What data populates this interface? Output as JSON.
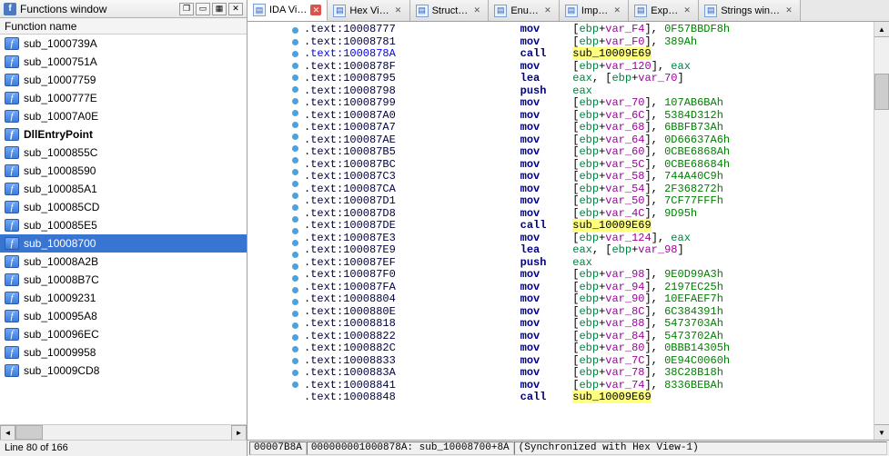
{
  "left": {
    "title": "Functions window",
    "col_header": "Function name",
    "status": "Line 80 of 166",
    "functions": [
      {
        "label": "sub_1000739A"
      },
      {
        "label": "sub_1000751A"
      },
      {
        "label": "sub_10007759"
      },
      {
        "label": "sub_1000777E"
      },
      {
        "label": "sub_10007A0E"
      },
      {
        "label": "DllEntryPoint",
        "bold": true
      },
      {
        "label": "sub_1000855C"
      },
      {
        "label": "sub_10008590"
      },
      {
        "label": "sub_100085A1"
      },
      {
        "label": "sub_100085CD"
      },
      {
        "label": "sub_100085E5"
      },
      {
        "label": "sub_10008700",
        "selected": true
      },
      {
        "label": "sub_10008A2B"
      },
      {
        "label": "sub_10008B7C"
      },
      {
        "label": "sub_10009231"
      },
      {
        "label": "sub_100095A8"
      },
      {
        "label": "sub_100096EC"
      },
      {
        "label": "sub_10009958"
      },
      {
        "label": "sub_10009CD8"
      }
    ]
  },
  "tabs": {
    "items": [
      {
        "label": "IDA Vi…",
        "active": true
      },
      {
        "label": "Hex Vi…"
      },
      {
        "label": "Struct…"
      },
      {
        "label": "Enu…"
      },
      {
        "label": "Imp…"
      },
      {
        "label": "Exp…"
      },
      {
        "label": "Strings win…"
      }
    ]
  },
  "disasm": {
    "lines": [
      {
        "addr": ".text:10008777",
        "mnem": "mov",
        "op": "[ebp+var_F4], 0F57BBDF8h",
        "ops": [
          {
            "t": "[",
            "c": ""
          },
          {
            "t": "ebp",
            "c": "regop"
          },
          {
            "t": "+",
            "c": ""
          },
          {
            "t": "var_F4",
            "c": "varop"
          },
          {
            "t": "], ",
            "c": ""
          },
          {
            "t": "0F57BBDF8h",
            "c": "imm"
          }
        ]
      },
      {
        "addr": ".text:10008781",
        "mnem": "mov",
        "ops": [
          {
            "t": "[",
            "c": ""
          },
          {
            "t": "ebp",
            "c": "regop"
          },
          {
            "t": "+",
            "c": ""
          },
          {
            "t": "var_F0",
            "c": "varop"
          },
          {
            "t": "], ",
            "c": ""
          },
          {
            "t": "389Ah",
            "c": "imm"
          }
        ]
      },
      {
        "addr": ".text:1000878A",
        "addr_blue": true,
        "mnem": "call",
        "ops": [
          {
            "t": "sub_10009E69",
            "c": "callhl"
          }
        ]
      },
      {
        "addr": ".text:1000878F",
        "mnem": "mov",
        "ops": [
          {
            "t": "[",
            "c": ""
          },
          {
            "t": "ebp",
            "c": "regop"
          },
          {
            "t": "+",
            "c": ""
          },
          {
            "t": "var_120",
            "c": "varop"
          },
          {
            "t": "], ",
            "c": ""
          },
          {
            "t": "eax",
            "c": "regop"
          }
        ]
      },
      {
        "addr": ".text:10008795",
        "mnem": "lea",
        "ops": [
          {
            "t": "eax",
            "c": "regop"
          },
          {
            "t": ", [",
            "c": ""
          },
          {
            "t": "ebp",
            "c": "regop"
          },
          {
            "t": "+",
            "c": ""
          },
          {
            "t": "var_70",
            "c": "varop"
          },
          {
            "t": "]",
            "c": ""
          }
        ]
      },
      {
        "addr": ".text:10008798",
        "mnem": "push",
        "ops": [
          {
            "t": "eax",
            "c": "regop"
          }
        ]
      },
      {
        "addr": ".text:10008799",
        "mnem": "mov",
        "ops": [
          {
            "t": "[",
            "c": ""
          },
          {
            "t": "ebp",
            "c": "regop"
          },
          {
            "t": "+",
            "c": ""
          },
          {
            "t": "var_70",
            "c": "varop"
          },
          {
            "t": "], ",
            "c": ""
          },
          {
            "t": "107AB6BAh",
            "c": "imm"
          }
        ]
      },
      {
        "addr": ".text:100087A0",
        "mnem": "mov",
        "ops": [
          {
            "t": "[",
            "c": ""
          },
          {
            "t": "ebp",
            "c": "regop"
          },
          {
            "t": "+",
            "c": ""
          },
          {
            "t": "var_6C",
            "c": "varop"
          },
          {
            "t": "], ",
            "c": ""
          },
          {
            "t": "5384D312h",
            "c": "imm"
          }
        ]
      },
      {
        "addr": ".text:100087A7",
        "mnem": "mov",
        "ops": [
          {
            "t": "[",
            "c": ""
          },
          {
            "t": "ebp",
            "c": "regop"
          },
          {
            "t": "+",
            "c": ""
          },
          {
            "t": "var_68",
            "c": "varop"
          },
          {
            "t": "], ",
            "c": ""
          },
          {
            "t": "6BBFB73Ah",
            "c": "imm"
          }
        ]
      },
      {
        "addr": ".text:100087AE",
        "mnem": "mov",
        "ops": [
          {
            "t": "[",
            "c": ""
          },
          {
            "t": "ebp",
            "c": "regop"
          },
          {
            "t": "+",
            "c": ""
          },
          {
            "t": "var_64",
            "c": "varop"
          },
          {
            "t": "], ",
            "c": ""
          },
          {
            "t": "0D66637A6h",
            "c": "imm"
          }
        ]
      },
      {
        "addr": ".text:100087B5",
        "mnem": "mov",
        "ops": [
          {
            "t": "[",
            "c": ""
          },
          {
            "t": "ebp",
            "c": "regop"
          },
          {
            "t": "+",
            "c": ""
          },
          {
            "t": "var_60",
            "c": "varop"
          },
          {
            "t": "], ",
            "c": ""
          },
          {
            "t": "0CBE6868Ah",
            "c": "imm"
          }
        ]
      },
      {
        "addr": ".text:100087BC",
        "mnem": "mov",
        "ops": [
          {
            "t": "[",
            "c": ""
          },
          {
            "t": "ebp",
            "c": "regop"
          },
          {
            "t": "+",
            "c": ""
          },
          {
            "t": "var_5C",
            "c": "varop"
          },
          {
            "t": "], ",
            "c": ""
          },
          {
            "t": "0CBE68684h",
            "c": "imm"
          }
        ]
      },
      {
        "addr": ".text:100087C3",
        "mnem": "mov",
        "ops": [
          {
            "t": "[",
            "c": ""
          },
          {
            "t": "ebp",
            "c": "regop"
          },
          {
            "t": "+",
            "c": ""
          },
          {
            "t": "var_58",
            "c": "varop"
          },
          {
            "t": "], ",
            "c": ""
          },
          {
            "t": "744A40C9h",
            "c": "imm"
          }
        ]
      },
      {
        "addr": ".text:100087CA",
        "mnem": "mov",
        "ops": [
          {
            "t": "[",
            "c": ""
          },
          {
            "t": "ebp",
            "c": "regop"
          },
          {
            "t": "+",
            "c": ""
          },
          {
            "t": "var_54",
            "c": "varop"
          },
          {
            "t": "], ",
            "c": ""
          },
          {
            "t": "2F368272h",
            "c": "imm"
          }
        ]
      },
      {
        "addr": ".text:100087D1",
        "mnem": "mov",
        "ops": [
          {
            "t": "[",
            "c": ""
          },
          {
            "t": "ebp",
            "c": "regop"
          },
          {
            "t": "+",
            "c": ""
          },
          {
            "t": "var_50",
            "c": "varop"
          },
          {
            "t": "], ",
            "c": ""
          },
          {
            "t": "7CF77FFFh",
            "c": "imm"
          }
        ]
      },
      {
        "addr": ".text:100087D8",
        "mnem": "mov",
        "ops": [
          {
            "t": "[",
            "c": ""
          },
          {
            "t": "ebp",
            "c": "regop"
          },
          {
            "t": "+",
            "c": ""
          },
          {
            "t": "var_4C",
            "c": "varop"
          },
          {
            "t": "], ",
            "c": ""
          },
          {
            "t": "9D95h",
            "c": "imm"
          }
        ]
      },
      {
        "addr": ".text:100087DE",
        "mnem": "call",
        "ops": [
          {
            "t": "sub_10009E69",
            "c": "callhl"
          }
        ]
      },
      {
        "addr": ".text:100087E3",
        "mnem": "mov",
        "ops": [
          {
            "t": "[",
            "c": ""
          },
          {
            "t": "ebp",
            "c": "regop"
          },
          {
            "t": "+",
            "c": ""
          },
          {
            "t": "var_124",
            "c": "varop"
          },
          {
            "t": "], ",
            "c": ""
          },
          {
            "t": "eax",
            "c": "regop"
          }
        ]
      },
      {
        "addr": ".text:100087E9",
        "mnem": "lea",
        "ops": [
          {
            "t": "eax",
            "c": "regop"
          },
          {
            "t": ", [",
            "c": ""
          },
          {
            "t": "ebp",
            "c": "regop"
          },
          {
            "t": "+",
            "c": ""
          },
          {
            "t": "var_98",
            "c": "varop"
          },
          {
            "t": "]",
            "c": ""
          }
        ]
      },
      {
        "addr": ".text:100087EF",
        "mnem": "push",
        "ops": [
          {
            "t": "eax",
            "c": "regop"
          }
        ]
      },
      {
        "addr": ".text:100087F0",
        "mnem": "mov",
        "ops": [
          {
            "t": "[",
            "c": ""
          },
          {
            "t": "ebp",
            "c": "regop"
          },
          {
            "t": "+",
            "c": ""
          },
          {
            "t": "var_98",
            "c": "varop"
          },
          {
            "t": "], ",
            "c": ""
          },
          {
            "t": "9E0D99A3h",
            "c": "imm"
          }
        ]
      },
      {
        "addr": ".text:100087FA",
        "mnem": "mov",
        "ops": [
          {
            "t": "[",
            "c": ""
          },
          {
            "t": "ebp",
            "c": "regop"
          },
          {
            "t": "+",
            "c": ""
          },
          {
            "t": "var_94",
            "c": "varop"
          },
          {
            "t": "], ",
            "c": ""
          },
          {
            "t": "2197EC25h",
            "c": "imm"
          }
        ]
      },
      {
        "addr": ".text:10008804",
        "mnem": "mov",
        "ops": [
          {
            "t": "[",
            "c": ""
          },
          {
            "t": "ebp",
            "c": "regop"
          },
          {
            "t": "+",
            "c": ""
          },
          {
            "t": "var_90",
            "c": "varop"
          },
          {
            "t": "], ",
            "c": ""
          },
          {
            "t": "10EFAEF7h",
            "c": "imm"
          }
        ]
      },
      {
        "addr": ".text:1000880E",
        "mnem": "mov",
        "ops": [
          {
            "t": "[",
            "c": ""
          },
          {
            "t": "ebp",
            "c": "regop"
          },
          {
            "t": "+",
            "c": ""
          },
          {
            "t": "var_8C",
            "c": "varop"
          },
          {
            "t": "], ",
            "c": ""
          },
          {
            "t": "6C384391h",
            "c": "imm"
          }
        ]
      },
      {
        "addr": ".text:10008818",
        "mnem": "mov",
        "ops": [
          {
            "t": "[",
            "c": ""
          },
          {
            "t": "ebp",
            "c": "regop"
          },
          {
            "t": "+",
            "c": ""
          },
          {
            "t": "var_88",
            "c": "varop"
          },
          {
            "t": "], ",
            "c": ""
          },
          {
            "t": "5473703Ah",
            "c": "imm"
          }
        ]
      },
      {
        "addr": ".text:10008822",
        "mnem": "mov",
        "ops": [
          {
            "t": "[",
            "c": ""
          },
          {
            "t": "ebp",
            "c": "regop"
          },
          {
            "t": "+",
            "c": ""
          },
          {
            "t": "var_84",
            "c": "varop"
          },
          {
            "t": "], ",
            "c": ""
          },
          {
            "t": "5473702Ah",
            "c": "imm"
          }
        ]
      },
      {
        "addr": ".text:1000882C",
        "mnem": "mov",
        "ops": [
          {
            "t": "[",
            "c": ""
          },
          {
            "t": "ebp",
            "c": "regop"
          },
          {
            "t": "+",
            "c": ""
          },
          {
            "t": "var_80",
            "c": "varop"
          },
          {
            "t": "], ",
            "c": ""
          },
          {
            "t": "0BBB14305h",
            "c": "imm"
          }
        ]
      },
      {
        "addr": ".text:10008833",
        "mnem": "mov",
        "ops": [
          {
            "t": "[",
            "c": ""
          },
          {
            "t": "ebp",
            "c": "regop"
          },
          {
            "t": "+",
            "c": ""
          },
          {
            "t": "var_7C",
            "c": "varop"
          },
          {
            "t": "], ",
            "c": ""
          },
          {
            "t": "0E94C0060h",
            "c": "imm"
          }
        ]
      },
      {
        "addr": ".text:1000883A",
        "mnem": "mov",
        "ops": [
          {
            "t": "[",
            "c": ""
          },
          {
            "t": "ebp",
            "c": "regop"
          },
          {
            "t": "+",
            "c": ""
          },
          {
            "t": "var_78",
            "c": "varop"
          },
          {
            "t": "], ",
            "c": ""
          },
          {
            "t": "38C28B18h",
            "c": "imm"
          }
        ]
      },
      {
        "addr": ".text:10008841",
        "mnem": "mov",
        "ops": [
          {
            "t": "[",
            "c": ""
          },
          {
            "t": "ebp",
            "c": "regop"
          },
          {
            "t": "+",
            "c": ""
          },
          {
            "t": "var_74",
            "c": "varop"
          },
          {
            "t": "], ",
            "c": ""
          },
          {
            "t": "8336BEBAh",
            "c": "imm"
          }
        ]
      },
      {
        "addr": ".text:10008848",
        "mnem": "call",
        "ops": [
          {
            "t": "sub_10009E69",
            "c": "callhl"
          }
        ]
      }
    ]
  },
  "status_right": {
    "offset": "00007B8A",
    "full": "000000001000878A: sub_10008700+8A",
    "sync": "(Synchronized with Hex View-1)"
  }
}
